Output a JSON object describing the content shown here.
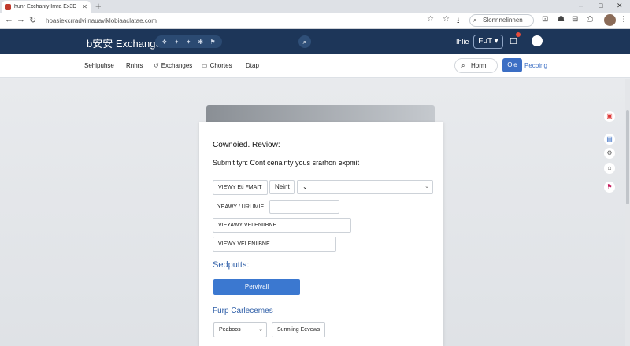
{
  "browser": {
    "tab_title": "hunr Exchaniy Imra Ex3D",
    "new_tab": "+",
    "min": "–",
    "max": "□",
    "close": "✕",
    "url": "hoasiexcrradvilnauaviklobiaaclatae.com",
    "search_label": "Slonnnelinnen",
    "icons": [
      "star-icon",
      "extension-icon",
      "user-avatar"
    ]
  },
  "site": {
    "brand": "b安安 Exchange",
    "header_pills": [
      "❖",
      "✦",
      "✦",
      "✱",
      "⚑"
    ],
    "hello": "Ihlie",
    "fuzzy_label": "FuT",
    "notif_icon": "chat-icon",
    "bell_icon": "bell-icon"
  },
  "subnav": {
    "items": [
      {
        "label": "Sehipuhse",
        "icon": ""
      },
      {
        "label": "Rnhrs",
        "icon": ""
      },
      {
        "label": "Exchanges",
        "icon": "↺"
      },
      {
        "label": "Chortes",
        "icon": "▭"
      },
      {
        "label": "Dtap",
        "icon": ""
      }
    ],
    "search_placeholder": "Horm",
    "primary_button": "Ole",
    "link": "Pecbing"
  },
  "card": {
    "title": "Cownoied. Reviow:",
    "subtitle": "Submit tyn: Cont cenainty yous srarhon expmit",
    "rows": [
      {
        "label": "VIEWY Eti FMAIT",
        "value": "Neint",
        "select": "⌄"
      },
      {
        "label": "YEAWY / URLIMIE",
        "value": ""
      },
      {
        "label": "VIEYAWY VELENIIBNE",
        "value": ""
      },
      {
        "label": "VIEWY VELENIIBNE",
        "value": ""
      }
    ],
    "section1": "Sedputts:",
    "primary_button": "Pervivall",
    "section2": "Furp Carlecemes",
    "select_label": "Peaboos",
    "select_caret": "⌄",
    "secondary_button": "Surmiing Eevews"
  },
  "rail": [
    "clip-icon",
    "doc-icon",
    "gear-icon",
    "home-icon",
    "flag-icon"
  ],
  "colors": {
    "header_bg": "#1d3659",
    "accent": "#3b78d0",
    "section_heading": "#2f5fa8"
  }
}
